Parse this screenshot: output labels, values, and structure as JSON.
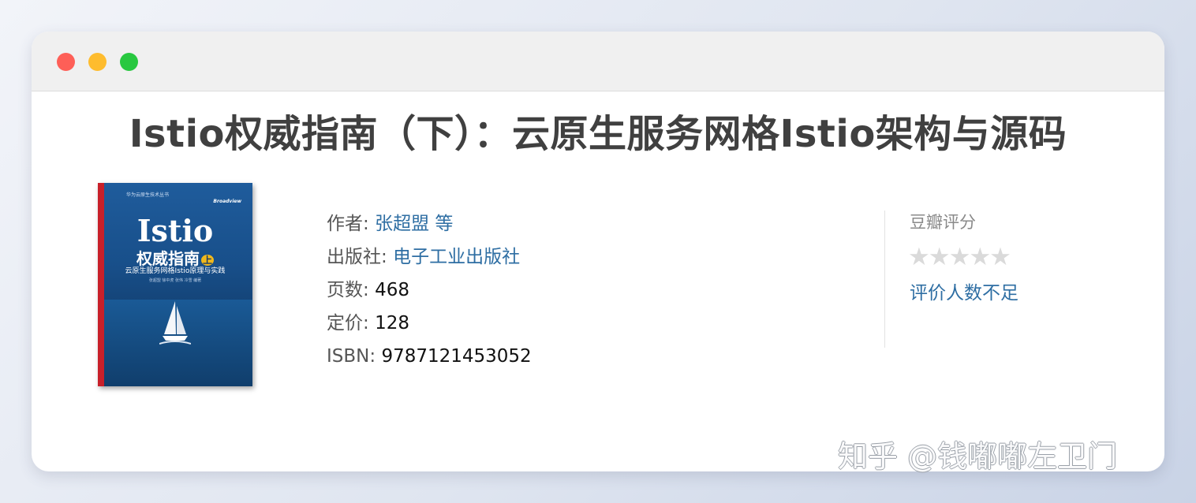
{
  "window": {
    "buttons": [
      "close",
      "minimize",
      "maximize"
    ]
  },
  "book": {
    "title": "Istio权威指南（下）：云原生服务网格Istio架构与源码",
    "cover": {
      "series": "华为云原生技术丛书",
      "brand": "Broadview",
      "main_title": "Istio",
      "cn_title": "权威指南",
      "volume": "上",
      "subtitle": "云原生服务网格Istio原理与实践",
      "authors": "张超盟 徐中虎 张伟 冷雪 编著"
    },
    "meta": {
      "author_label": "作者:",
      "author_value": "张超盟 等",
      "publisher_label": "出版社:",
      "publisher_value": "电子工业出版社",
      "pages_label": "页数:",
      "pages_value": "468",
      "price_label": "定价:",
      "price_value": "128",
      "isbn_label": "ISBN:",
      "isbn_value": "9787121453052"
    }
  },
  "rating": {
    "label": "豆瓣评分",
    "stars": "★★★★★",
    "stars_filled": 0,
    "star_color": "#dadada",
    "text": "评价人数不足"
  },
  "watermark": "知乎 @钱嘟嘟左卫门",
  "colors": {
    "link": "#2e6ea3",
    "title": "#404040"
  }
}
